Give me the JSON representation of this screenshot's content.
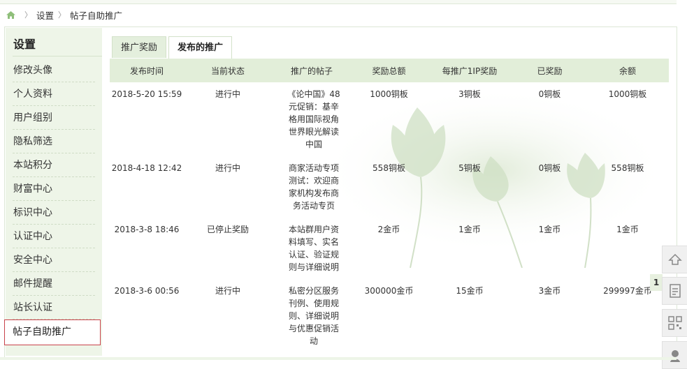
{
  "breadcrumb": {
    "items": [
      "设置",
      "帖子自助推广"
    ]
  },
  "sidebar": {
    "title": "设置",
    "items": [
      {
        "label": "修改头像"
      },
      {
        "label": "个人资料"
      },
      {
        "label": "用户组别"
      },
      {
        "label": "隐私筛选"
      },
      {
        "label": "本站积分"
      },
      {
        "label": "财富中心"
      },
      {
        "label": "标识中心"
      },
      {
        "label": "认证中心"
      },
      {
        "label": "安全中心"
      },
      {
        "label": "邮件提醒"
      },
      {
        "label": "站长认证"
      },
      {
        "label": "帖子自助推广",
        "active": true
      }
    ]
  },
  "tabs": [
    {
      "label": "推广奖励",
      "active": false
    },
    {
      "label": "发布的推广",
      "active": true
    }
  ],
  "table": {
    "headers": [
      "发布时间",
      "当前状态",
      "推广的帖子",
      "奖励总额",
      "每推广1IP奖励",
      "已奖励",
      "余额"
    ],
    "rows": [
      [
        "2018-5-20 15:59",
        "进行中",
        "《论中国》48元促销：基辛格用国际视角世界眼光解读中国",
        "1000铜板",
        "3铜板",
        "0铜板",
        "1000铜板"
      ],
      [
        "2018-4-18 12:42",
        "进行中",
        "商家活动专项测试：欢迎商家机构发布商务活动专页",
        "558铜板",
        "5铜板",
        "0铜板",
        "558铜板"
      ],
      [
        "2018-3-8 18:46",
        "已停止奖励",
        "本站群用户资料填写、实名认证、验证规则与详细说明",
        "2金币",
        "1金币",
        "1金币",
        "1金币"
      ],
      [
        "2018-3-6 00:56",
        "进行中",
        "私密分区服务刊例、使用规则、详细说明与优惠促销活动",
        "300000金币",
        "15金币",
        "3金币",
        "299997金币"
      ]
    ]
  },
  "floating": {
    "page_badge": "1",
    "icons": [
      "back-to-top-icon",
      "document-icon",
      "qrcode-icon",
      "support-icon"
    ]
  },
  "colors": {
    "accent_green": "#e2eed9",
    "sidebar_bg": "#eef5e8",
    "active_border": "#c8424a"
  }
}
